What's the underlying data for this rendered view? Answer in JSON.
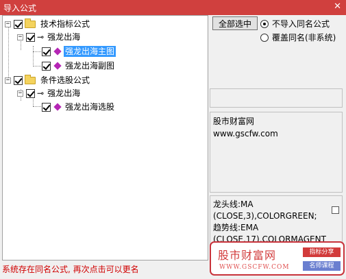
{
  "window": {
    "title": "导入公式",
    "close_symbol": "✕"
  },
  "tree": {
    "nodes": [
      {
        "label": "技术指标公式"
      },
      {
        "label": "强龙出海"
      },
      {
        "label": "强龙出海主图"
      },
      {
        "label": "强龙出海副图"
      },
      {
        "label": "条件选股公式"
      },
      {
        "label": "强龙出海"
      },
      {
        "label": "强龙出海选股"
      }
    ],
    "expanded_symbol": "−",
    "key_symbol": "⊸"
  },
  "actions": {
    "select_all_label": "全部选中",
    "radio_no_import_label": "不导入同名公式",
    "radio_overwrite_label": "覆盖同名(非系统)"
  },
  "info": {
    "line1": "股市财富网",
    "line2": "www.gscfw.com"
  },
  "code": {
    "line1": "龙头线:MA",
    "line2": "(CLOSE,3),COLORGREEN;",
    "line3": "趋势线:EMA",
    "line4": "(CLOSE,17),COLORMAGENT"
  },
  "status": {
    "message": "系统存在同名公式, 再次点击可以更名"
  },
  "watermark": {
    "title": "股市财富网",
    "url": "WWW.GSCFW.COM",
    "tag1": "指标分享",
    "tag2": "名师课程"
  },
  "colors": {
    "titlebar": "#d0403e",
    "selection": "#3399ff",
    "status_text": "#d00000",
    "diamond": "#b526b5",
    "folder": "#f4d35e"
  }
}
